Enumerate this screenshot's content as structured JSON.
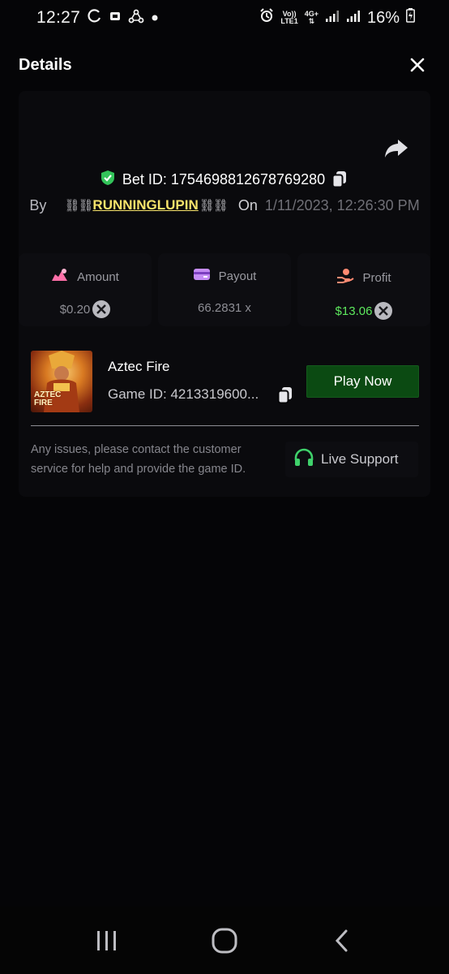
{
  "status_bar": {
    "time": "12:27",
    "volte_label": "Vo))",
    "lte_label": "LTE1",
    "network_label": "4G+",
    "battery": "16%"
  },
  "header": {
    "title": "Details"
  },
  "bet": {
    "bet_id_label": "Bet ID:",
    "bet_id": "1754698812678769280",
    "by_label": "By",
    "chain_left": "⛓⛓",
    "username": "RUNNINGLUPIN",
    "chain_right": "⛓⛓",
    "on_label": "On",
    "date": "1/11/2023, 12:26:30 PM"
  },
  "stats": {
    "amount": {
      "label": "Amount",
      "value": "$0.20"
    },
    "payout": {
      "label": "Payout",
      "value": "66.2831 x"
    },
    "profit": {
      "label": "Profit",
      "value": "$13.06"
    }
  },
  "game": {
    "thumb_line1": "AZTEC",
    "thumb_line2": "FIRE",
    "name": "Aztec Fire",
    "game_id_label": "Game ID: 4213319600...",
    "play_label": "Play Now"
  },
  "support": {
    "help_text": "Any issues, please contact the customer service for help and provide the game ID.",
    "live_support_label": "Live Support"
  },
  "colors": {
    "accent_green": "#5de85d",
    "play_button": "#0b4a12",
    "username_yellow": "#f7e36b",
    "background": "#050507"
  }
}
